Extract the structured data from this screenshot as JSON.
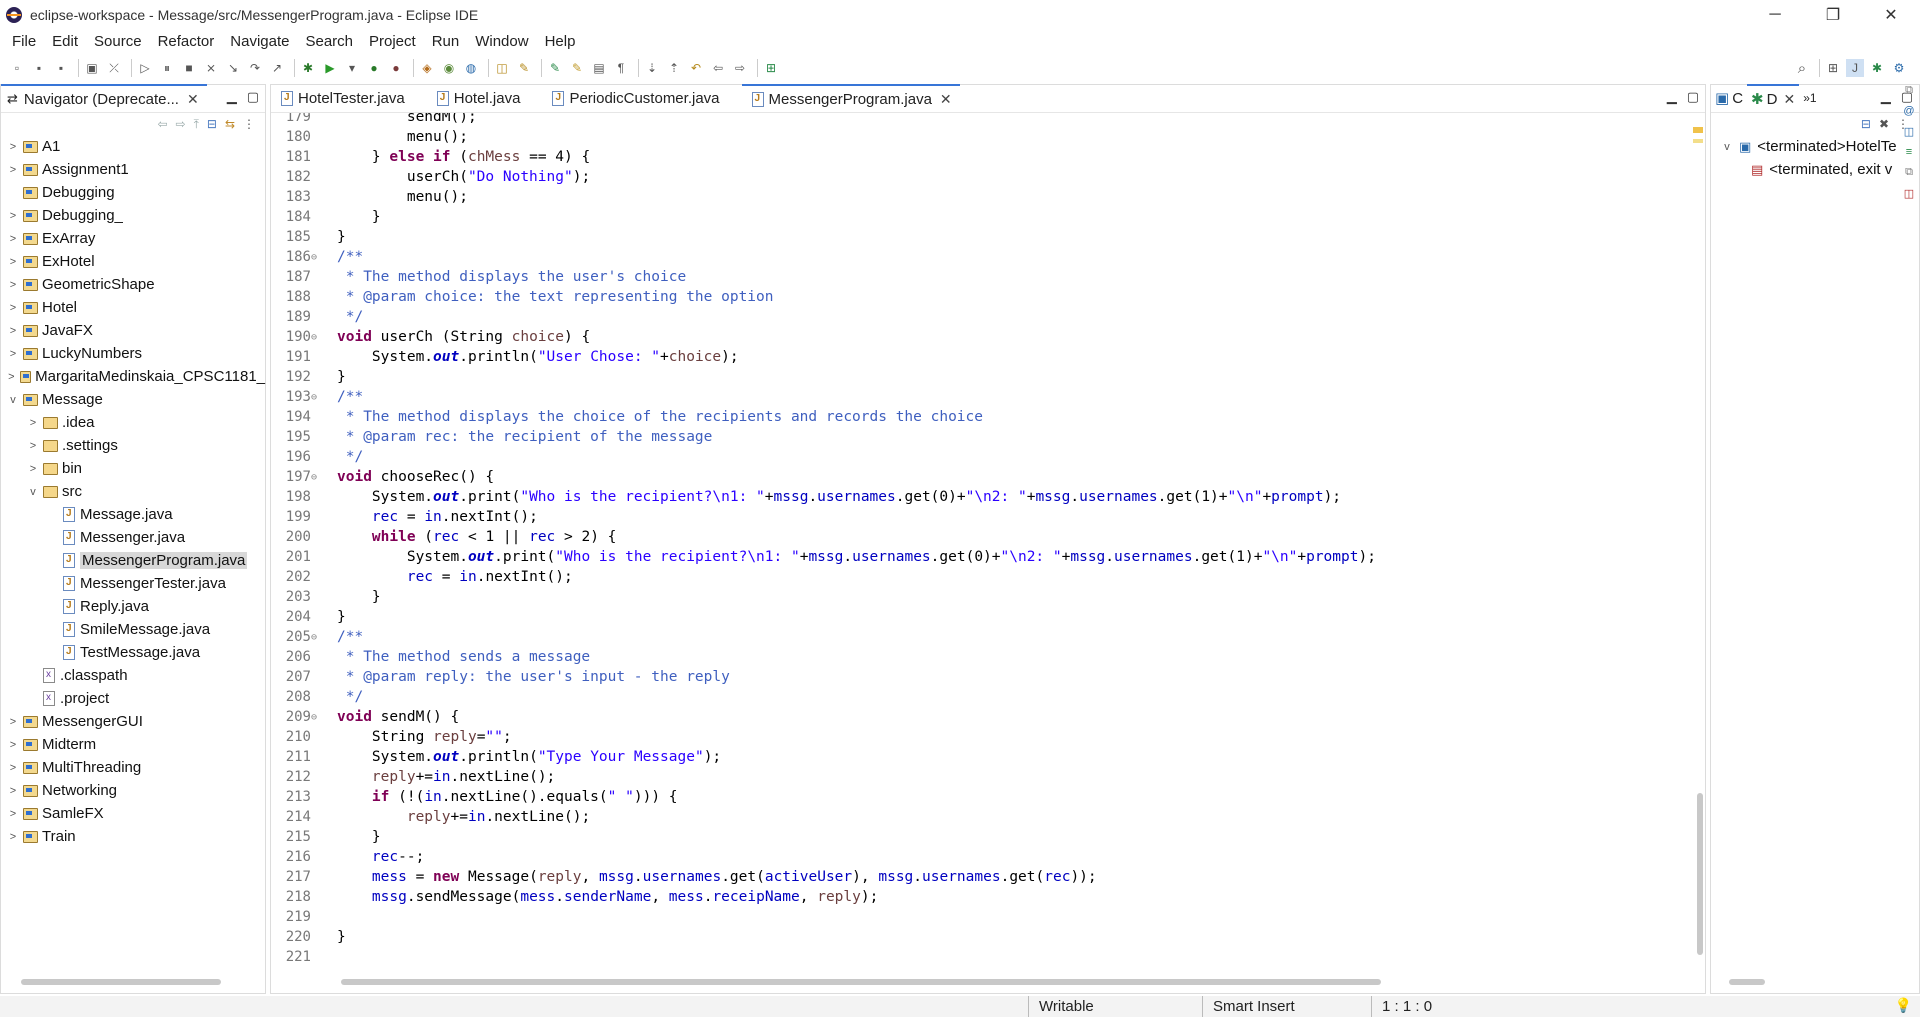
{
  "window": {
    "title": "eclipse-workspace - Message/src/MessengerProgram.java - Eclipse IDE",
    "minimize": "─",
    "restore": "❐",
    "close": "✕"
  },
  "menu": [
    "File",
    "Edit",
    "Source",
    "Refactor",
    "Navigate",
    "Search",
    "Project",
    "Run",
    "Window",
    "Help"
  ],
  "navigator": {
    "tab_label": "Navigator (Deprecate...",
    "close": "✕",
    "items": [
      {
        "label": "A1",
        "depth": 0,
        "type": "project",
        "expand": ">"
      },
      {
        "label": "Assignment1",
        "depth": 0,
        "type": "project",
        "expand": ">"
      },
      {
        "label": "Debugging",
        "depth": 0,
        "type": "project",
        "expand": ""
      },
      {
        "label": "Debugging_",
        "depth": 0,
        "type": "project",
        "expand": ">"
      },
      {
        "label": "ExArray",
        "depth": 0,
        "type": "project",
        "expand": ">"
      },
      {
        "label": "ExHotel",
        "depth": 0,
        "type": "project",
        "expand": ">"
      },
      {
        "label": "GeometricShape",
        "depth": 0,
        "type": "project",
        "expand": ">"
      },
      {
        "label": "Hotel",
        "depth": 0,
        "type": "project",
        "expand": ">"
      },
      {
        "label": "JavaFX",
        "depth": 0,
        "type": "project",
        "expand": ">"
      },
      {
        "label": "LuckyNumbers",
        "depth": 0,
        "type": "project",
        "expand": ">"
      },
      {
        "label": "MargaritaMedinskaia_CPSC1181_",
        "depth": 0,
        "type": "project",
        "expand": ">"
      },
      {
        "label": "Message",
        "depth": 0,
        "type": "project",
        "expand": "v"
      },
      {
        "label": ".idea",
        "depth": 1,
        "type": "folder",
        "expand": ">"
      },
      {
        "label": ".settings",
        "depth": 1,
        "type": "folder",
        "expand": ">"
      },
      {
        "label": "bin",
        "depth": 1,
        "type": "folder",
        "expand": ">"
      },
      {
        "label": "src",
        "depth": 1,
        "type": "folder",
        "expand": "v"
      },
      {
        "label": "Message.java",
        "depth": 2,
        "type": "java",
        "expand": ""
      },
      {
        "label": "Messenger.java",
        "depth": 2,
        "type": "java",
        "expand": ""
      },
      {
        "label": "MessengerProgram.java",
        "depth": 2,
        "type": "java",
        "expand": "",
        "selected": true
      },
      {
        "label": "MessengerTester.java",
        "depth": 2,
        "type": "java",
        "expand": ""
      },
      {
        "label": "Reply.java",
        "depth": 2,
        "type": "java",
        "expand": ""
      },
      {
        "label": "SmileMessage.java",
        "depth": 2,
        "type": "java",
        "expand": ""
      },
      {
        "label": "TestMessage.java",
        "depth": 2,
        "type": "java",
        "expand": ""
      },
      {
        "label": ".classpath",
        "depth": 1,
        "type": "xml",
        "expand": ""
      },
      {
        "label": ".project",
        "depth": 1,
        "type": "xml",
        "expand": ""
      },
      {
        "label": "MessengerGUI",
        "depth": 0,
        "type": "project",
        "expand": ">"
      },
      {
        "label": "Midterm",
        "depth": 0,
        "type": "project",
        "expand": ">"
      },
      {
        "label": "MultiThreading",
        "depth": 0,
        "type": "project",
        "expand": ">"
      },
      {
        "label": "Networking",
        "depth": 0,
        "type": "project",
        "expand": ">"
      },
      {
        "label": "SamleFX",
        "depth": 0,
        "type": "project",
        "expand": ">"
      },
      {
        "label": "Train",
        "depth": 0,
        "type": "project",
        "expand": ">"
      }
    ]
  },
  "editor": {
    "tabs": [
      {
        "label": "HotelTester.java",
        "active": false
      },
      {
        "label": "Hotel.java",
        "active": false
      },
      {
        "label": "PeriodicCustomer.java",
        "active": false
      },
      {
        "label": "MessengerProgram.java",
        "active": true
      }
    ],
    "tab_close": "✕",
    "lines": [
      {
        "n": "179",
        "fold": "",
        "segs": [
          [
            "sp",
            "        "
          ],
          [
            "t",
            "sendM();"
          ]
        ]
      },
      {
        "n": "180",
        "fold": "",
        "segs": [
          [
            "sp",
            "        "
          ],
          [
            "t",
            "menu();"
          ]
        ]
      },
      {
        "n": "181",
        "fold": "",
        "segs": [
          [
            "sp",
            "    "
          ],
          [
            "t",
            "} "
          ],
          [
            "kw",
            "else if"
          ],
          [
            "t",
            " ("
          ],
          [
            "var",
            "chMess"
          ],
          [
            "t",
            " == 4) {"
          ]
        ]
      },
      {
        "n": "182",
        "fold": "",
        "segs": [
          [
            "sp",
            "        "
          ],
          [
            "t",
            "userCh("
          ],
          [
            "str",
            "\"Do Nothing\""
          ],
          [
            "t",
            ");"
          ]
        ]
      },
      {
        "n": "183",
        "fold": "",
        "segs": [
          [
            "sp",
            "        "
          ],
          [
            "t",
            "menu();"
          ]
        ]
      },
      {
        "n": "184",
        "fold": "",
        "segs": [
          [
            "sp",
            "    "
          ],
          [
            "t",
            "}"
          ]
        ]
      },
      {
        "n": "185",
        "fold": "",
        "segs": [
          [
            "t",
            "}"
          ]
        ]
      },
      {
        "n": "186",
        "fold": "⊖",
        "segs": [
          [
            "cm",
            "/**"
          ]
        ]
      },
      {
        "n": "187",
        "fold": "",
        "segs": [
          [
            "cm",
            " * The method displays the user's choice"
          ]
        ]
      },
      {
        "n": "188",
        "fold": "",
        "segs": [
          [
            "cm",
            " * @param choice: the text representing the option"
          ]
        ]
      },
      {
        "n": "189",
        "fold": "",
        "segs": [
          [
            "cm",
            " */"
          ]
        ]
      },
      {
        "n": "190",
        "fold": "⊖",
        "segs": [
          [
            "kw",
            "void"
          ],
          [
            "t",
            " userCh (String "
          ],
          [
            "var",
            "choice"
          ],
          [
            "t",
            ") {"
          ]
        ]
      },
      {
        "n": "191",
        "fold": "",
        "segs": [
          [
            "sp",
            "    "
          ],
          [
            "t",
            "System."
          ],
          [
            "sfld",
            "out"
          ],
          [
            "t",
            ".println("
          ],
          [
            "str",
            "\"User Chose: \""
          ],
          [
            "t",
            "+"
          ],
          [
            "var",
            "choice"
          ],
          [
            "t",
            ");"
          ]
        ]
      },
      {
        "n": "192",
        "fold": "",
        "segs": [
          [
            "t",
            "}"
          ]
        ]
      },
      {
        "n": "193",
        "fold": "⊖",
        "segs": [
          [
            "cm",
            "/**"
          ]
        ]
      },
      {
        "n": "194",
        "fold": "",
        "segs": [
          [
            "cm",
            " * The method displays the choice of the recipients and records the choice"
          ]
        ]
      },
      {
        "n": "195",
        "fold": "",
        "segs": [
          [
            "cm",
            " * @param rec: the recipient of the message"
          ]
        ]
      },
      {
        "n": "196",
        "fold": "",
        "segs": [
          [
            "cm",
            " */"
          ]
        ]
      },
      {
        "n": "197",
        "fold": "⊖",
        "segs": [
          [
            "kw",
            "void"
          ],
          [
            "t",
            " chooseRec() {"
          ]
        ]
      },
      {
        "n": "198",
        "fold": "",
        "segs": [
          [
            "sp",
            "    "
          ],
          [
            "t",
            "System."
          ],
          [
            "sfld",
            "out"
          ],
          [
            "t",
            ".print("
          ],
          [
            "str",
            "\"Who is the recipient?\\n1: \""
          ],
          [
            "t",
            "+"
          ],
          [
            "fld",
            "mssg"
          ],
          [
            "t",
            "."
          ],
          [
            "fld",
            "usernames"
          ],
          [
            "t",
            ".get(0)+"
          ],
          [
            "str",
            "\"\\n2: \""
          ],
          [
            "t",
            "+"
          ],
          [
            "fld",
            "mssg"
          ],
          [
            "t",
            "."
          ],
          [
            "fld",
            "usernames"
          ],
          [
            "t",
            ".get(1)+"
          ],
          [
            "str",
            "\"\\n\""
          ],
          [
            "t",
            "+"
          ],
          [
            "fld",
            "prompt"
          ],
          [
            "t",
            ");"
          ]
        ]
      },
      {
        "n": "199",
        "fold": "",
        "segs": [
          [
            "sp",
            "    "
          ],
          [
            "fld",
            "rec"
          ],
          [
            "t",
            " = "
          ],
          [
            "fld",
            "in"
          ],
          [
            "t",
            ".nextInt();"
          ]
        ]
      },
      {
        "n": "200",
        "fold": "",
        "segs": [
          [
            "sp",
            "    "
          ],
          [
            "kw",
            "while"
          ],
          [
            "t",
            " ("
          ],
          [
            "fld",
            "rec"
          ],
          [
            "t",
            " < 1 || "
          ],
          [
            "fld",
            "rec"
          ],
          [
            "t",
            " > 2) {"
          ]
        ]
      },
      {
        "n": "201",
        "fold": "",
        "segs": [
          [
            "sp",
            "        "
          ],
          [
            "t",
            "System."
          ],
          [
            "sfld",
            "out"
          ],
          [
            "t",
            ".print("
          ],
          [
            "str",
            "\"Who is the recipient?\\n1: \""
          ],
          [
            "t",
            "+"
          ],
          [
            "fld",
            "mssg"
          ],
          [
            "t",
            "."
          ],
          [
            "fld",
            "usernames"
          ],
          [
            "t",
            ".get(0)+"
          ],
          [
            "str",
            "\"\\n2: \""
          ],
          [
            "t",
            "+"
          ],
          [
            "fld",
            "mssg"
          ],
          [
            "t",
            "."
          ],
          [
            "fld",
            "usernames"
          ],
          [
            "t",
            ".get(1)+"
          ],
          [
            "str",
            "\"\\n\""
          ],
          [
            "t",
            "+"
          ],
          [
            "fld",
            "prompt"
          ],
          [
            "t",
            ");"
          ]
        ]
      },
      {
        "n": "202",
        "fold": "",
        "segs": [
          [
            "sp",
            "        "
          ],
          [
            "fld",
            "rec"
          ],
          [
            "t",
            " = "
          ],
          [
            "fld",
            "in"
          ],
          [
            "t",
            ".nextInt();"
          ]
        ]
      },
      {
        "n": "203",
        "fold": "",
        "segs": [
          [
            "sp",
            "    "
          ],
          [
            "t",
            "}"
          ]
        ]
      },
      {
        "n": "204",
        "fold": "",
        "segs": [
          [
            "t",
            "}"
          ]
        ]
      },
      {
        "n": "205",
        "fold": "⊖",
        "segs": [
          [
            "cm",
            "/**"
          ]
        ]
      },
      {
        "n": "206",
        "fold": "",
        "segs": [
          [
            "cm",
            " * The method sends a message"
          ]
        ]
      },
      {
        "n": "207",
        "fold": "",
        "segs": [
          [
            "cm",
            " * @param reply: the user's input - the reply"
          ]
        ]
      },
      {
        "n": "208",
        "fold": "",
        "segs": [
          [
            "cm",
            " */"
          ]
        ]
      },
      {
        "n": "209",
        "fold": "⊖",
        "segs": [
          [
            "kw",
            "void"
          ],
          [
            "t",
            " sendM() {"
          ]
        ]
      },
      {
        "n": "210",
        "fold": "",
        "segs": [
          [
            "sp",
            "    "
          ],
          [
            "t",
            "String "
          ],
          [
            "var",
            "reply"
          ],
          [
            "t",
            "="
          ],
          [
            "str",
            "\"\""
          ],
          [
            "t",
            ";"
          ]
        ]
      },
      {
        "n": "211",
        "fold": "",
        "segs": [
          [
            "sp",
            "    "
          ],
          [
            "t",
            "System."
          ],
          [
            "sfld",
            "out"
          ],
          [
            "t",
            ".println("
          ],
          [
            "str",
            "\"Type Your Message\""
          ],
          [
            "t",
            ");"
          ]
        ]
      },
      {
        "n": "212",
        "fold": "",
        "segs": [
          [
            "sp",
            "    "
          ],
          [
            "var",
            "reply"
          ],
          [
            "t",
            "+="
          ],
          [
            "fld",
            "in"
          ],
          [
            "t",
            ".nextLine();"
          ]
        ]
      },
      {
        "n": "213",
        "fold": "",
        "segs": [
          [
            "sp",
            "    "
          ],
          [
            "kw",
            "if"
          ],
          [
            "t",
            " (!("
          ],
          [
            "fld",
            "in"
          ],
          [
            "t",
            ".nextLine().equals("
          ],
          [
            "str",
            "\" \""
          ],
          [
            "t",
            "))) {"
          ]
        ]
      },
      {
        "n": "214",
        "fold": "",
        "segs": [
          [
            "sp",
            "        "
          ],
          [
            "var",
            "reply"
          ],
          [
            "t",
            "+="
          ],
          [
            "fld",
            "in"
          ],
          [
            "t",
            ".nextLine();"
          ]
        ]
      },
      {
        "n": "215",
        "fold": "",
        "segs": [
          [
            "sp",
            "    "
          ],
          [
            "t",
            "}"
          ]
        ]
      },
      {
        "n": "216",
        "fold": "",
        "segs": [
          [
            "sp",
            "    "
          ],
          [
            "fld",
            "rec"
          ],
          [
            "t",
            "--;"
          ]
        ]
      },
      {
        "n": "217",
        "fold": "",
        "segs": [
          [
            "sp",
            "    "
          ],
          [
            "fld",
            "mess"
          ],
          [
            "t",
            " = "
          ],
          [
            "kw",
            "new"
          ],
          [
            "t",
            " Message("
          ],
          [
            "var",
            "reply"
          ],
          [
            "t",
            ", "
          ],
          [
            "fld",
            "mssg"
          ],
          [
            "t",
            "."
          ],
          [
            "fld",
            "usernames"
          ],
          [
            "t",
            ".get("
          ],
          [
            "fld",
            "activeUser"
          ],
          [
            "t",
            "), "
          ],
          [
            "fld",
            "mssg"
          ],
          [
            "t",
            "."
          ],
          [
            "fld",
            "usernames"
          ],
          [
            "t",
            ".get("
          ],
          [
            "fld",
            "rec"
          ],
          [
            "t",
            "));"
          ]
        ]
      },
      {
        "n": "218",
        "fold": "",
        "segs": [
          [
            "sp",
            "    "
          ],
          [
            "fld",
            "mssg"
          ],
          [
            "t",
            ".sendMessage("
          ],
          [
            "fld",
            "mess"
          ],
          [
            "t",
            "."
          ],
          [
            "fld",
            "senderName"
          ],
          [
            "t",
            ", "
          ],
          [
            "fld",
            "mess"
          ],
          [
            "t",
            "."
          ],
          [
            "fld",
            "receipName"
          ],
          [
            "t",
            ", "
          ],
          [
            "var",
            "reply"
          ],
          [
            "t",
            ");"
          ]
        ]
      },
      {
        "n": "219",
        "fold": "",
        "segs": []
      },
      {
        "n": "220",
        "fold": "",
        "segs": [
          [
            "t",
            "}"
          ]
        ]
      },
      {
        "n": "221",
        "fold": "",
        "segs": []
      }
    ]
  },
  "right_view": {
    "tab_c": "C",
    "tab_d": "D",
    "close": "✕",
    "overflow": "»1",
    "tree": [
      {
        "label": "<terminated>HotelTe",
        "depth": 0
      },
      {
        "label": "<terminated, exit v",
        "depth": 1
      }
    ]
  },
  "status": {
    "writable": "Writable",
    "insert_mode": "Smart Insert",
    "position": "1 : 1 : 0"
  }
}
